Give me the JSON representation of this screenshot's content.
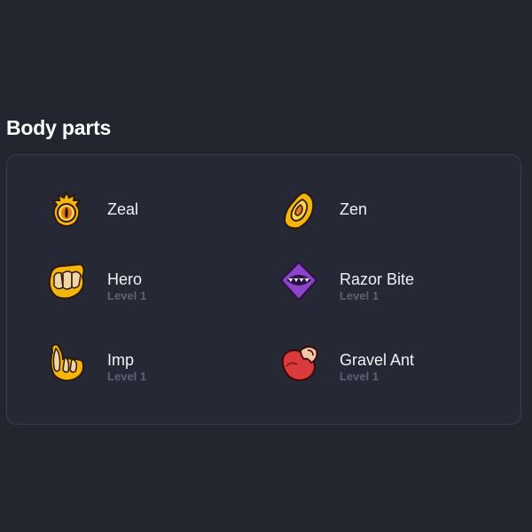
{
  "section": {
    "title": "Body parts"
  },
  "parts": [
    {
      "name": "Zeal",
      "level": "",
      "icon": "eye-icon",
      "color": "#f5b50a"
    },
    {
      "name": "Zen",
      "level": "",
      "icon": "gem-eye-icon",
      "color": "#f5b50a"
    },
    {
      "name": "Hero",
      "level": "Level 1",
      "icon": "fist-icon",
      "color": "#f5b50a"
    },
    {
      "name": "Razor Bite",
      "level": "Level 1",
      "icon": "mouth-icon",
      "color": "#8e44c8"
    },
    {
      "name": "Imp",
      "level": "Level 1",
      "icon": "horns-icon",
      "color": "#f5b50a"
    },
    {
      "name": "Gravel Ant",
      "level": "Level 1",
      "icon": "claw-icon",
      "color": "#d93a3a"
    }
  ]
}
